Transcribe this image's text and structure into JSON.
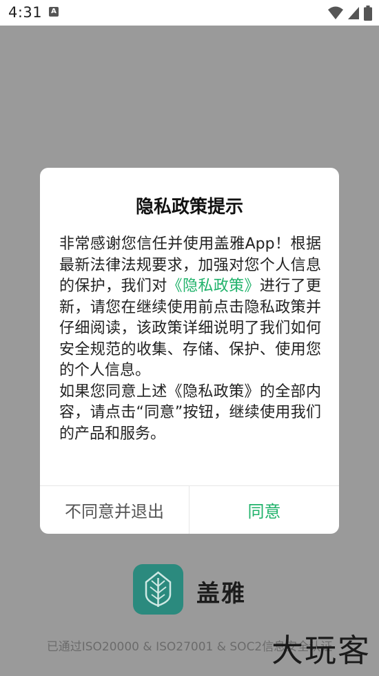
{
  "status_bar": {
    "time": "4:31",
    "notification_icon": "a-icon",
    "icons": [
      "wifi-icon",
      "signal-icon",
      "battery-icon"
    ]
  },
  "app": {
    "name": "盖雅",
    "logo_icon": "tree-leaf-icon",
    "certification": "已通过ISO20000 & ISO27001 & SOC2信息安全认证",
    "watermark": "大玩客"
  },
  "dialog": {
    "title": "隐私政策提示",
    "para1_a": "非常感谢您信任并使用盖雅App！根据最新法律法规要求，加强对您个人信息的保护，我们对",
    "para1_link": "《隐私政策》",
    "para1_b": "进行了更新，请您在继续使用前点击隐私政策并仔细阅读，该政策详细说明了我们如何安全规范的收集、存储、保护、使用您的个人信息。",
    "para2": "如果您同意上述《隐私政策》的全部内容，请点击“同意”按钮，继续使用我们的产品和服务。",
    "disagree_label": "不同意并退出",
    "agree_label": "同意"
  },
  "colors": {
    "accent": "#1fb26a",
    "overlay": "#9a9a9a",
    "logo": "#2b8a7e"
  }
}
